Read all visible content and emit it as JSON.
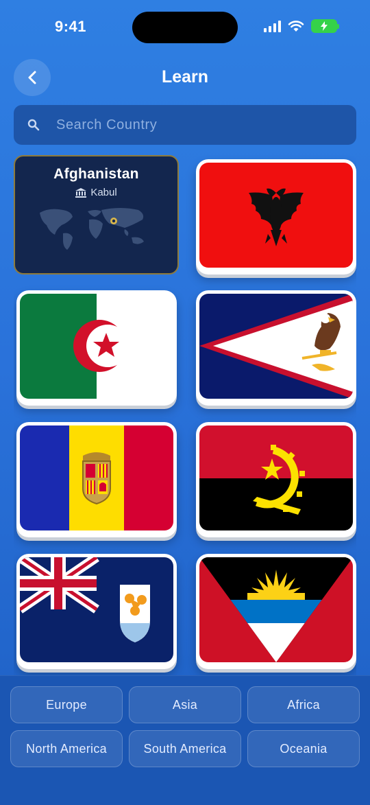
{
  "status": {
    "time": "9:41"
  },
  "header": {
    "title": "Learn"
  },
  "search": {
    "placeholder": "Search Country"
  },
  "selected_country": {
    "name": "Afghanistan",
    "capital": "Kabul"
  },
  "flags": [
    "Albania",
    "Algeria",
    "American Samoa",
    "Andorra",
    "Angola",
    "Anguilla",
    "Antigua and Barbuda"
  ],
  "regions": [
    "Europe",
    "Asia",
    "Africa",
    "North America",
    "South America",
    "Oceania"
  ],
  "colors": {
    "background": "#2a72da",
    "search_bg": "#1e55a8",
    "info_card_bg": "#13264e",
    "info_card_border": "#8e7a3a",
    "footer_bg": "#1b56b3"
  }
}
